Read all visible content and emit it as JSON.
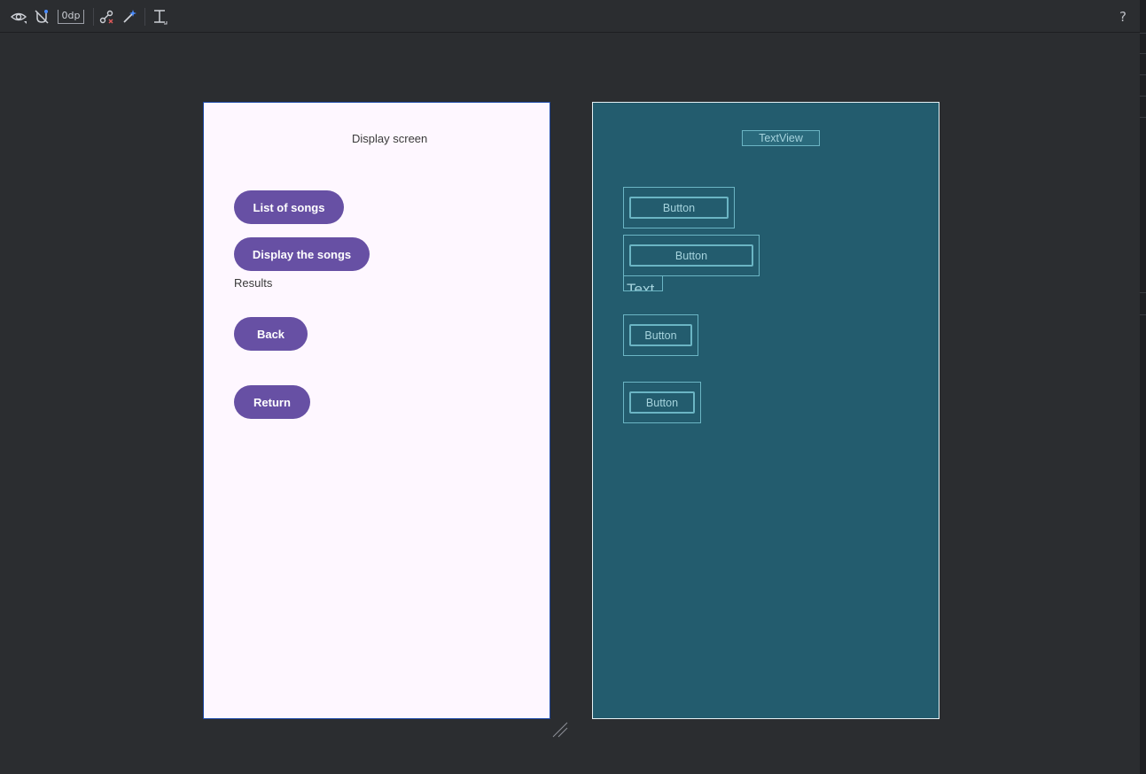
{
  "toolbar": {
    "eye_icon": "eye-icon",
    "constraints_icon": "magnet-off-icon",
    "default_margin": "0dp",
    "clear_constraints_icon": "clear-constraints-icon",
    "infer_constraints_icon": "magic-wand-icon",
    "guidelines_icon": "text-baseline-icon",
    "help_label": "?"
  },
  "design": {
    "title": "Display screen",
    "buttons": [
      "List of songs",
      "Display the songs",
      "Back",
      "Return"
    ],
    "results_label": "Results"
  },
  "blueprint": {
    "textview_label": "TextView",
    "text_label": "Text",
    "button_label": "Button"
  },
  "colors": {
    "accent": "#6750a4",
    "canvas_bg": "#fef7ff",
    "blueprint_bg": "#235c6e",
    "blueprint_line": "#6bb5c4"
  }
}
